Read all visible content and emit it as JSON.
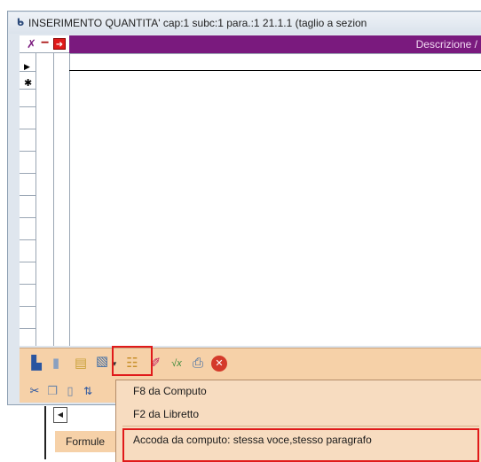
{
  "window": {
    "title": "INSERIMENTO QUANTITA' cap:1 subc:1 para.:1    21.1.1  (taglio a sezion"
  },
  "grid": {
    "header_label": "Descrizione /"
  },
  "toolbar": {
    "icons": [
      "save-icon",
      "database-icon",
      "export-icon",
      "paste-icon",
      "dropdown-arrow-icon",
      "list-icon",
      "eraser-icon",
      "formula-icon",
      "print-icon",
      "close-icon"
    ]
  },
  "menu": {
    "items": [
      {
        "label": "F8 da Computo"
      },
      {
        "label": "F2 da Libretto"
      },
      {
        "label": "Accoda da computo: stessa voce,stesso paragrafo"
      }
    ]
  },
  "bottom": {
    "tab_label": "Formule"
  }
}
